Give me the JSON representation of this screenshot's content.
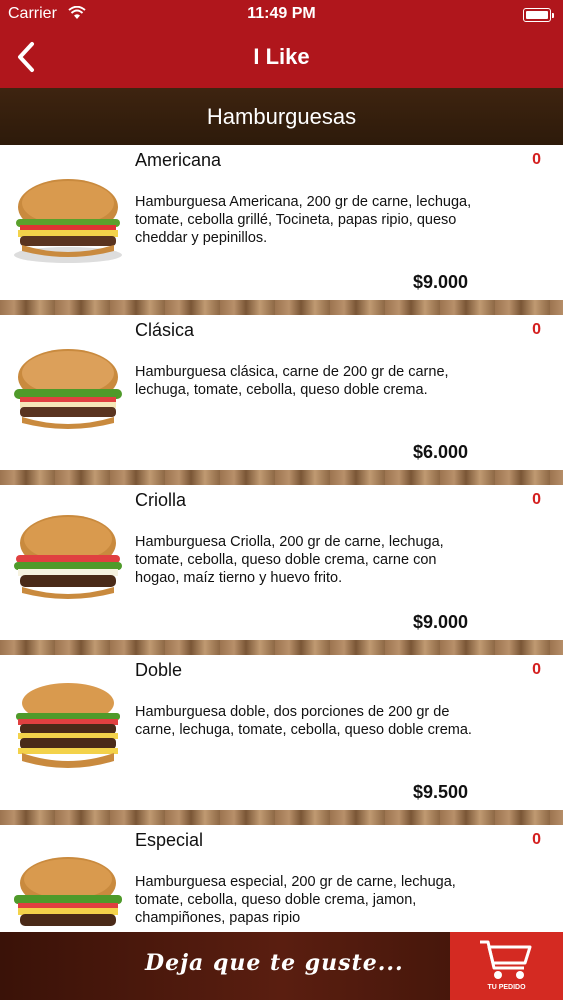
{
  "status": {
    "carrier": "Carrier",
    "time": "11:49 PM"
  },
  "nav": {
    "title": "I Like",
    "back_icon": "chevron-left-icon"
  },
  "section": {
    "title": "Hamburguesas"
  },
  "items": [
    {
      "name": "Americana",
      "count": "0",
      "description": "Hamburguesa Americana,  200 gr de carne, lechuga, tomate, cebolla grillé, Tocineta, papas ripio, queso cheddar y pepinillos.",
      "price": "$9.000"
    },
    {
      "name": "Clásica",
      "count": "0",
      "description": "Hamburguesa clásica, carne de 200 gr de carne, lechuga, tomate, cebolla, queso doble crema.",
      "price": "$6.000"
    },
    {
      "name": "Criolla",
      "count": "0",
      "description": "Hamburguesa Criolla, 200 gr de carne, lechuga, tomate, cebolla, queso doble crema, carne con hogao, maíz tierno y huevo frito.",
      "price": "$9.000"
    },
    {
      "name": "Doble",
      "count": "0",
      "description": "Hamburguesa doble, dos porciones de 200 gr de carne, lechuga, tomate, cebolla, queso doble crema.",
      "price": "$9.500"
    },
    {
      "name": "Especial",
      "count": "0",
      "description": "Hamburguesa especial, 200 gr de carne, lechuga, tomate, cebolla, queso doble crema, jamon, champiñones, papas ripio",
      "price": ""
    }
  ],
  "footer": {
    "slogan": "Deja que te guste...",
    "cart_label": "TU PEDIDO",
    "cart_icon": "shopping-cart-icon"
  },
  "colors": {
    "primary": "#b0161c",
    "header_brown": "#3e2410",
    "count_red": "#d41f1f",
    "cart_red": "#d42a22"
  }
}
